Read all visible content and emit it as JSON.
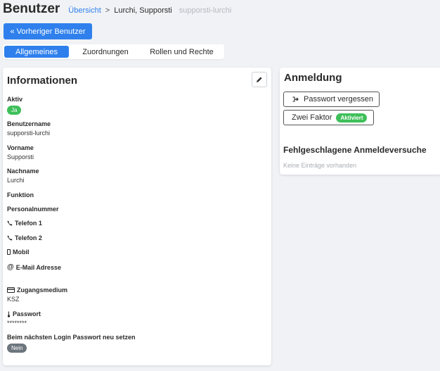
{
  "header": {
    "title": "Benutzer",
    "breadcrumb_link": "Übersicht",
    "breadcrumb_separator": ">",
    "breadcrumb_current": "Lurchi, Supporsti",
    "breadcrumb_sub": "supporsti-lurchi"
  },
  "prev_button": {
    "label": "« Vorheriger Benutzer"
  },
  "tabs": [
    {
      "label": "Allgemeines",
      "active": true
    },
    {
      "label": "Zuordnungen",
      "active": false
    },
    {
      "label": "Rollen und Rechte",
      "active": false
    }
  ],
  "info": {
    "title": "Informationen",
    "fields": {
      "aktiv": {
        "label": "Aktiv",
        "value": "Ja"
      },
      "benutzername": {
        "label": "Benutzername",
        "value": "supporsti-lurchi"
      },
      "vorname": {
        "label": "Vorname",
        "value": "Supporsti"
      },
      "nachname": {
        "label": "Nachname",
        "value": "Lurchi"
      },
      "funktion": {
        "label": "Funktion"
      },
      "personalnummer": {
        "label": "Personalnummer"
      },
      "telefon1": {
        "label": "Telefon 1"
      },
      "telefon2": {
        "label": "Telefon 2"
      },
      "mobil": {
        "label": "Mobil"
      },
      "email": {
        "label": "E-Mail Adresse"
      },
      "zugangsmedium": {
        "label": "Zugangsmedium",
        "value": "KSZ"
      },
      "passwort": {
        "label": "Passwort",
        "value": "********"
      },
      "reset": {
        "label": "Beim nächsten Login Passwort neu setzen",
        "value": "Nein"
      }
    }
  },
  "login": {
    "title": "Anmeldung",
    "forgot_password": "Passwort vergessen",
    "two_factor": "Zwei Faktor",
    "two_factor_status": "Aktiviert",
    "failed_title": "Fehlgeschlagene Anmeldeversuche",
    "failed_empty": "Keine Einträge vorhanden"
  },
  "colors": {
    "primary": "#2f80ed",
    "success": "#3fbf5a",
    "muted": "#6c757d",
    "background": "#f0f2f5"
  }
}
